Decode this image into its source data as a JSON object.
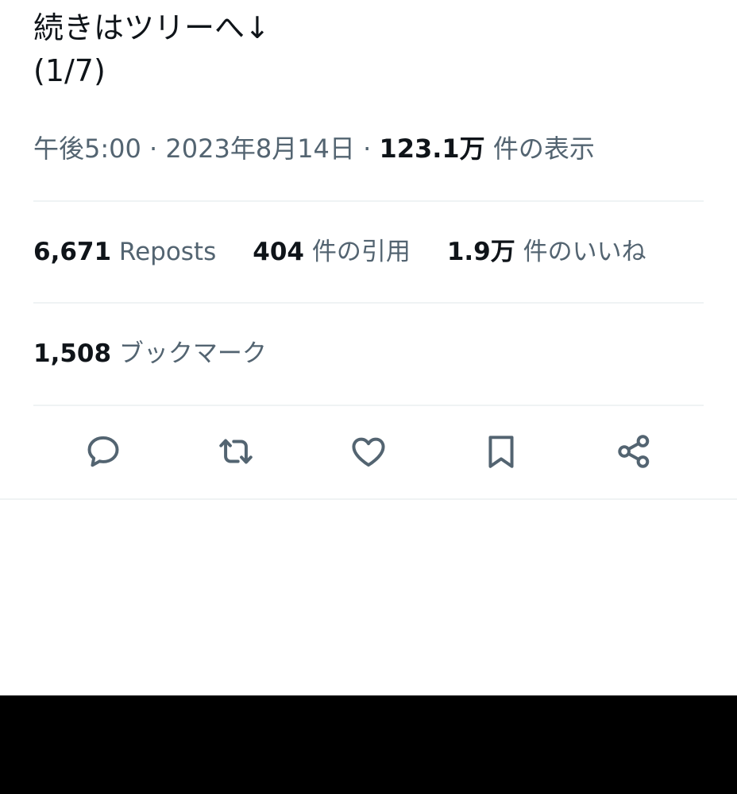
{
  "tweet": {
    "text_line1": "続きはツリーへ↓",
    "text_line2": "(1/7)"
  },
  "meta": {
    "time": "午後5:00",
    "date": "2023年8月14日",
    "sep": "·",
    "views_count": "123.1万",
    "views_label": "件の表示"
  },
  "stats": {
    "reposts_count": "6,671",
    "reposts_label": "Reposts",
    "quotes_count": "404",
    "quotes_label": "件の引用",
    "likes_count": "1.9万",
    "likes_label": "件のいいね",
    "bookmarks_count": "1,508",
    "bookmarks_label": "ブックマーク"
  },
  "actions": {
    "icons": [
      "reply-icon",
      "repost-icon",
      "like-icon",
      "bookmark-icon",
      "share-icon"
    ]
  },
  "colors": {
    "text_primary": "#0f1419",
    "text_secondary": "#536471",
    "divider": "#eff3f4",
    "background": "#ffffff"
  }
}
